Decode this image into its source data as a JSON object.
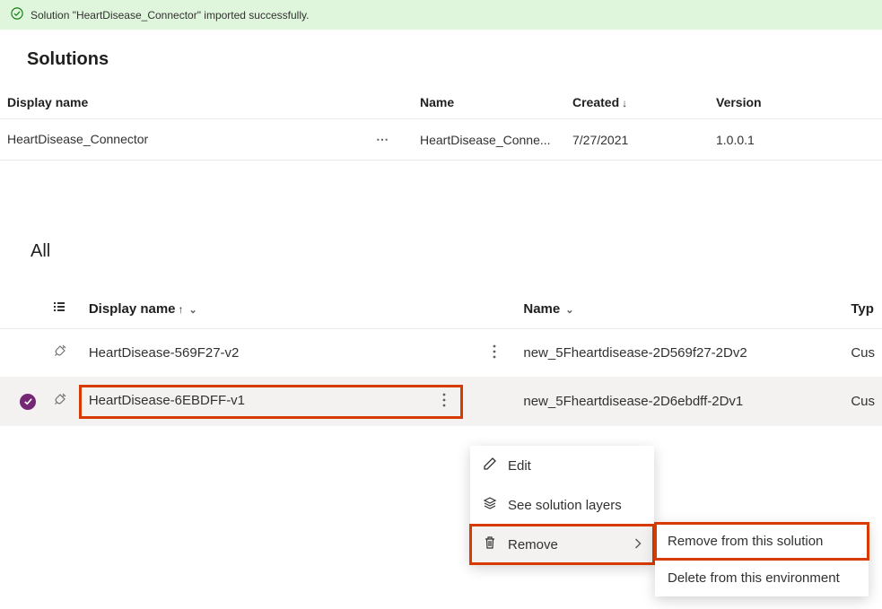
{
  "notification": {
    "text": "Solution \"HeartDisease_Connector\" imported successfully."
  },
  "solutions": {
    "title": "Solutions",
    "columns": {
      "display_name": "Display name",
      "name": "Name",
      "created": "Created",
      "version": "Version"
    },
    "row": {
      "display_name": "HeartDisease_Connector",
      "name": "HeartDisease_Conne...",
      "created": "7/27/2021",
      "version": "1.0.0.1"
    }
  },
  "all": {
    "title": "All",
    "columns": {
      "display_name": "Display name",
      "name": "Name",
      "type": "Typ"
    },
    "rows": [
      {
        "display_name": "HeartDisease-569F27-v2",
        "name": "new_5Fheartdisease-2D569f27-2Dv2",
        "type": "Cus",
        "selected": false
      },
      {
        "display_name": "HeartDisease-6EBDFF-v1",
        "name": "new_5Fheartdisease-2D6ebdff-2Dv1",
        "type": "Cus",
        "selected": true
      }
    ]
  },
  "menu": {
    "edit": "Edit",
    "layers": "See solution layers",
    "remove": "Remove"
  },
  "submenu": {
    "remove_from_solution": "Remove from this solution",
    "delete_from_env": "Delete from this environment"
  }
}
